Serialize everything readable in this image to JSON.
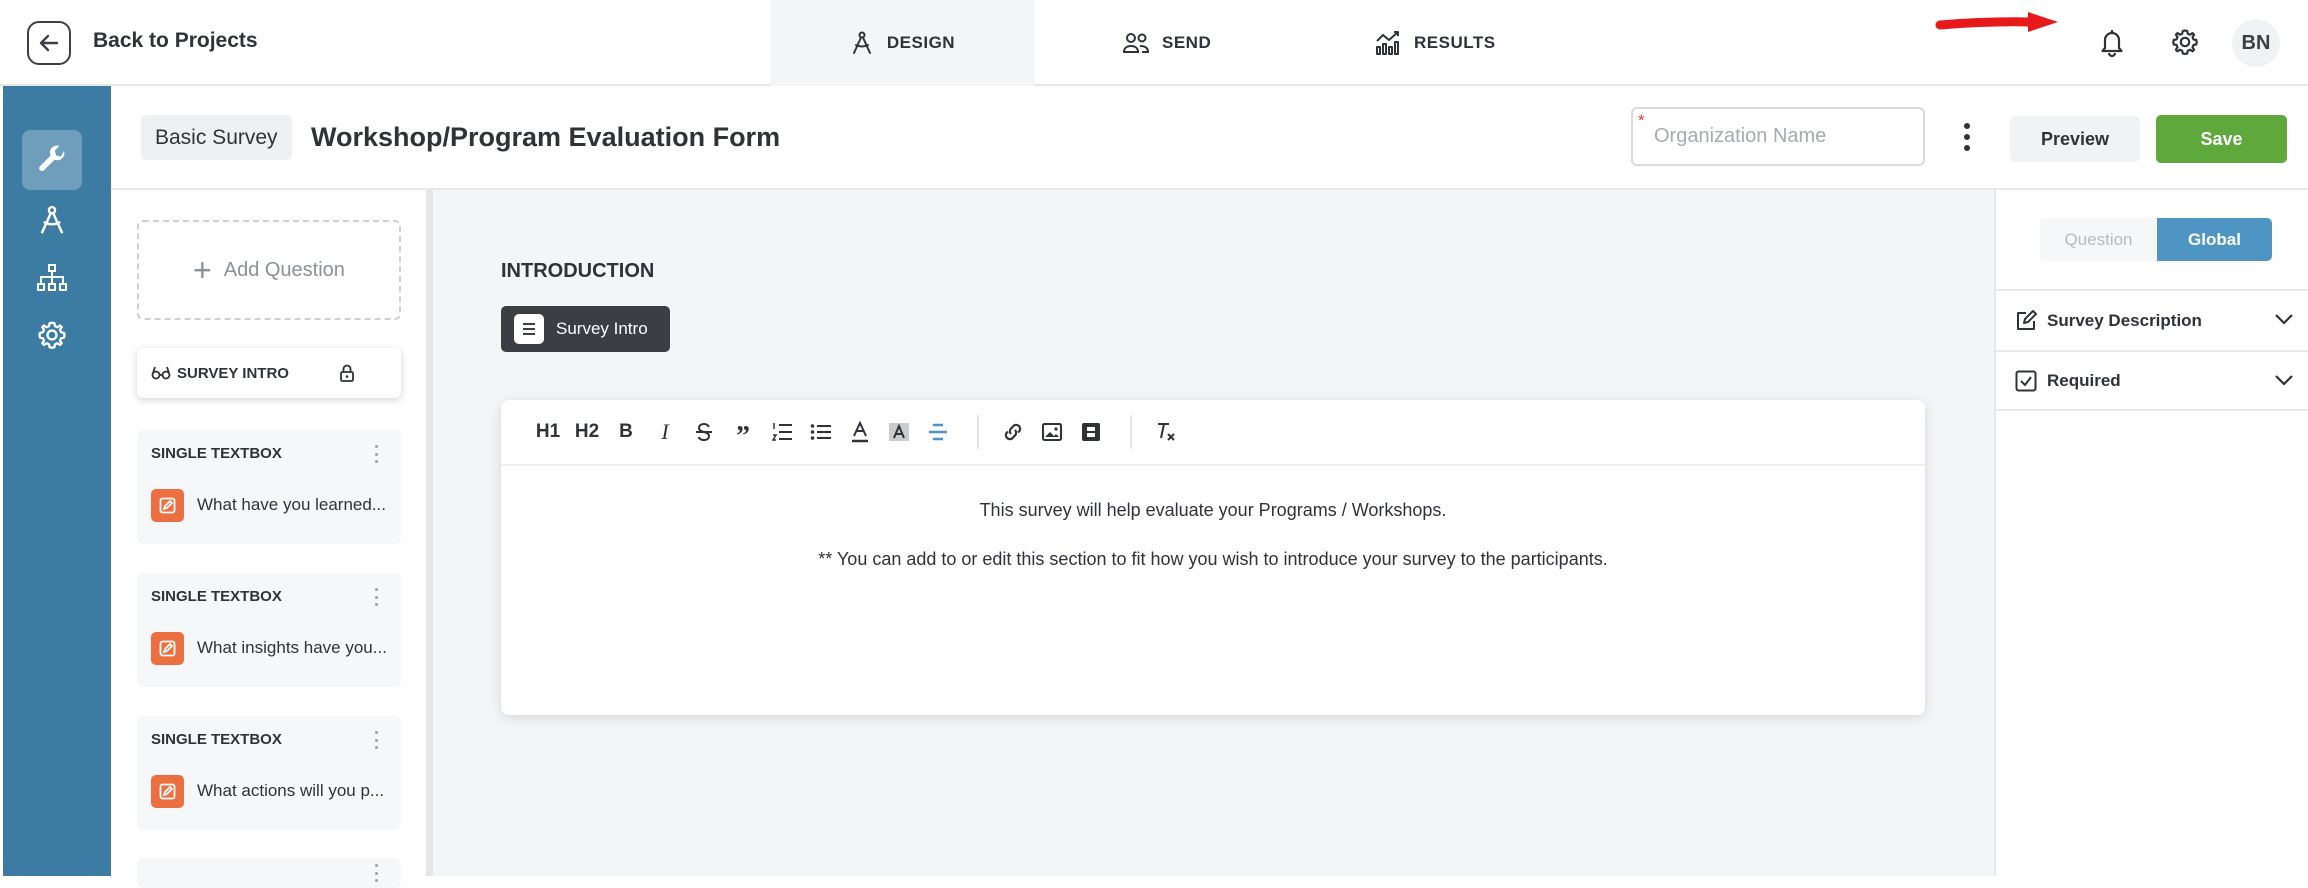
{
  "topbar": {
    "back_label": "Back to Projects",
    "tabs": [
      {
        "label": "DESIGN",
        "icon": "compass-icon",
        "active": true
      },
      {
        "label": "SEND",
        "icon": "users-icon",
        "active": false
      },
      {
        "label": "RESULTS",
        "icon": "chart-icon",
        "active": false
      }
    ],
    "icons": [
      "bell-icon",
      "gear-icon"
    ],
    "avatar_initials": "BN"
  },
  "sidebar": {
    "items": [
      {
        "icon": "wrench-icon",
        "active": true
      },
      {
        "icon": "compass-icon",
        "active": false
      },
      {
        "icon": "sitemap-icon",
        "active": false
      },
      {
        "icon": "gear-icon",
        "active": false
      }
    ],
    "accent_color": "#3c7ba2"
  },
  "header": {
    "survey_type": "Basic Survey",
    "title": "Workshop/Program Evaluation Form",
    "org_field": {
      "value": "",
      "placeholder": "Organization Name",
      "required_mark": "*"
    },
    "preview_label": "Preview",
    "save_label": "Save",
    "save_color": "#5ea83c"
  },
  "question_panel": {
    "add_label": "Add Question",
    "intro_card": {
      "label": "SURVEY INTRO"
    },
    "questions": [
      {
        "type": "SINGLE TEXTBOX",
        "text": "What have you learned..."
      },
      {
        "type": "SINGLE TEXTBOX",
        "text": "What insights have you..."
      },
      {
        "type": "SINGLE TEXTBOX",
        "text": "What actions will you p..."
      }
    ]
  },
  "canvas": {
    "section_heading": "INTRODUCTION",
    "chip_label": "Survey Intro",
    "toolbar": {
      "h1": "H1",
      "h2": "H2",
      "bold": "B",
      "italic": "I",
      "quote": "”"
    },
    "lines": [
      "This survey will help evaluate your Programs / Workshops.",
      "** You can add to or edit this section to fit how you wish to introduce your survey to the participants."
    ]
  },
  "settings_panel": {
    "toggle": {
      "question": "Question",
      "global": "Global",
      "selected": "Global"
    },
    "rows": [
      {
        "label": "Survey Description",
        "icon": "edit-icon"
      },
      {
        "label": "Required",
        "icon": "checkbox-icon"
      }
    ]
  }
}
